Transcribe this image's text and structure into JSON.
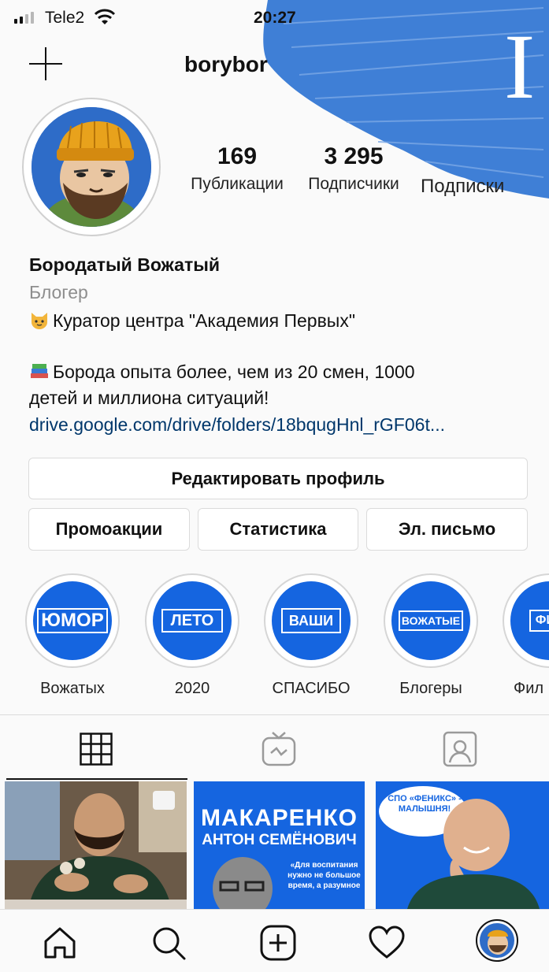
{
  "status_bar": {
    "carrier": "Tele2",
    "time": "20:27"
  },
  "header": {
    "username": "borybor"
  },
  "stats": [
    {
      "value": "169",
      "label": "Публикации"
    },
    {
      "value": "3 295",
      "label": "Подписчики"
    },
    {
      "value": "",
      "label": "Подписки"
    }
  ],
  "bio": {
    "name": "Бородатый Вожатый",
    "category": "Блогер",
    "line1": "Куратор центра \"Академия Первых\"",
    "line2": "Борода опыта более, чем из 20 смен, 1000",
    "line3": "детей и миллиона ситуаций!",
    "link": "drive.google.com/drive/folders/18bqugHnl_rGF06t..."
  },
  "buttons": {
    "edit_profile": "Редактировать профиль",
    "promotions": "Промоакции",
    "insights": "Статистика",
    "email": "Эл. письмо"
  },
  "highlights": [
    {
      "cover": "ЮМОР",
      "label": "Вожатых"
    },
    {
      "cover": "ЛЕТО",
      "label": "2020"
    },
    {
      "cover": "ВАШИ",
      "label": "СПАСИБО"
    },
    {
      "cover": "ВОЖАТЫЕ",
      "label": "Блогеры"
    },
    {
      "cover": "ФИЛ",
      "label": "Фил"
    }
  ],
  "tabs": [
    "grid-icon",
    "igtv-icon",
    "tagged-icon"
  ],
  "posts": {
    "post2_title1": "МАКАРЕНКО",
    "post2_title2": "АНТОН СЕМЁНОВИЧ",
    "post2_quote": "«Для воспитания нужно не большое время, а разумное",
    "post3_bubble": "СПО «ФЕНИКС» - МАЛЫШНЯ!"
  },
  "bottom_nav": [
    "home-icon",
    "search-icon",
    "new-post-icon",
    "activity-icon",
    "profile-avatar"
  ],
  "colors": {
    "accent_blue": "#1565e0",
    "link": "#00376b",
    "streak": "#3f7fd6"
  }
}
